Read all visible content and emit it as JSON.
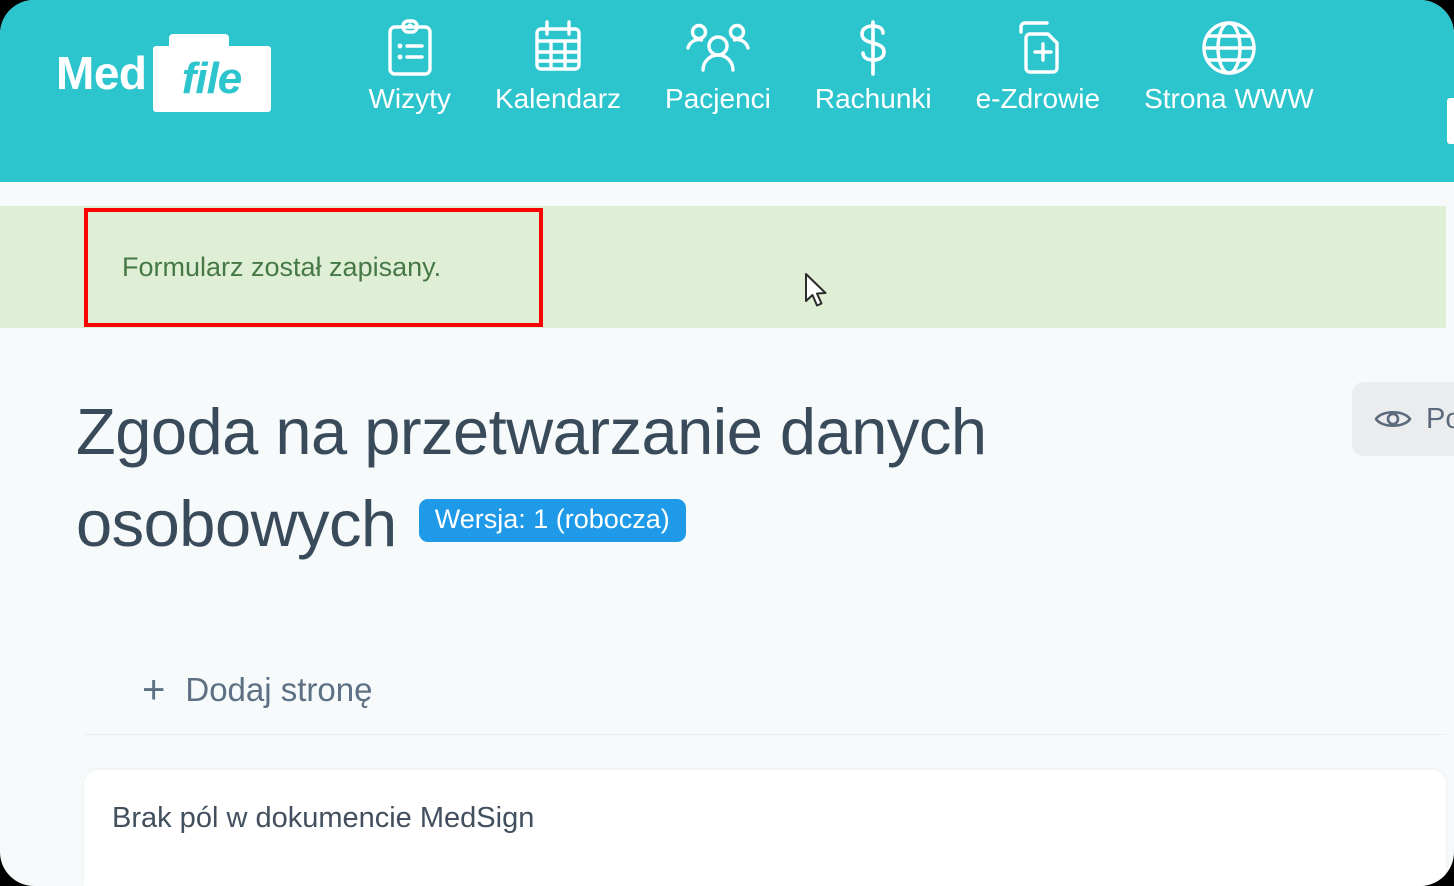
{
  "app": {
    "logo_primary": "Med",
    "logo_secondary": "file"
  },
  "nav": {
    "items": [
      {
        "label": "Wizyty",
        "icon": "clipboard-checklist-icon"
      },
      {
        "label": "Kalendarz",
        "icon": "calendar-icon"
      },
      {
        "label": "Pacjenci",
        "icon": "users-icon"
      },
      {
        "label": "Rachunki",
        "icon": "dollar-sign-icon"
      },
      {
        "label": "e-Zdrowie",
        "icon": "medical-document-icon"
      },
      {
        "label": "Strona WWW",
        "icon": "globe-icon"
      }
    ]
  },
  "alert": {
    "message": "Formularz został zapisany.",
    "type": "success",
    "background": "#dfefd5",
    "text_color": "#477947",
    "highlight_border": "#fa0202"
  },
  "page": {
    "title": "Zgoda na przetwarzanie danych osobowych",
    "version_badge": "Wersja: 1 (robocza)",
    "version_badge_color": "#1e9ae8"
  },
  "toolbar": {
    "preview_label": "Po",
    "preview_icon": "eye-icon"
  },
  "actions": {
    "add_page_label": "Dodaj stronę",
    "add_page_icon": "plus-icon"
  },
  "content": {
    "empty_message": "Brak pól w dokumencie MedSign"
  },
  "theme": {
    "navbar": "#2dc5cd",
    "page_background": "#f6fafb",
    "title_color": "#394a5a"
  }
}
